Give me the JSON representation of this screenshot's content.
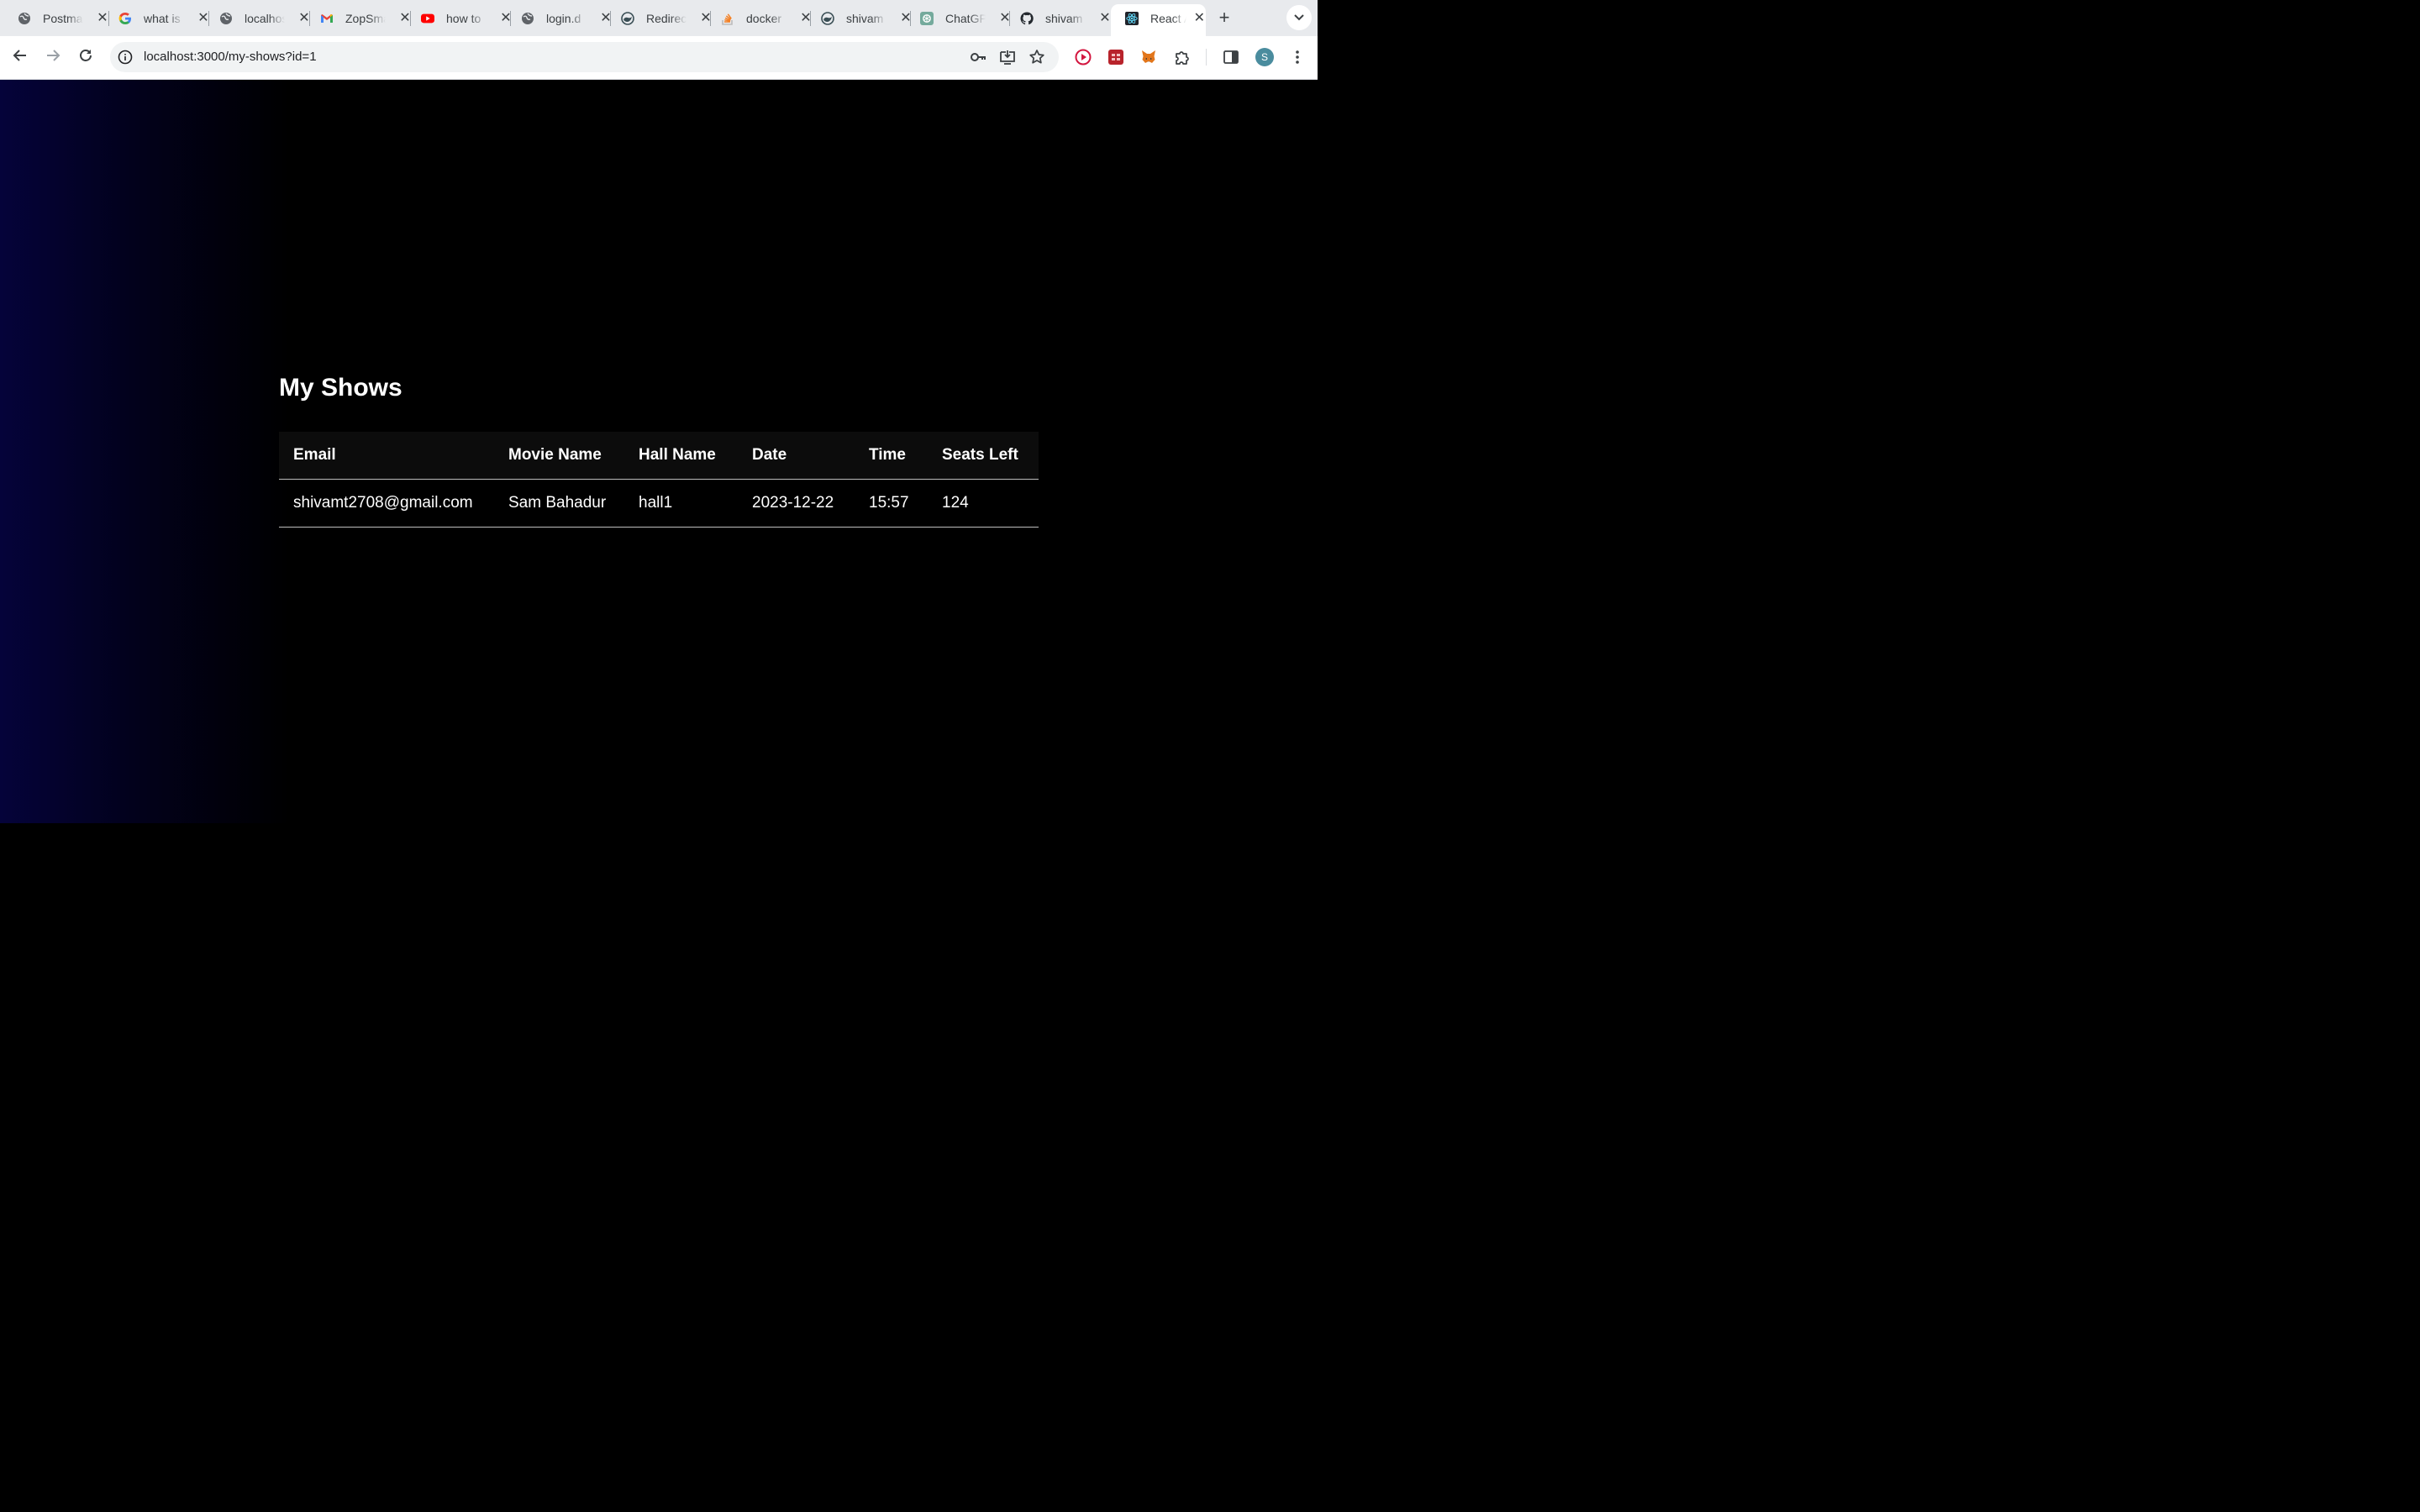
{
  "browser": {
    "tabs": [
      {
        "title": "Postman",
        "icon": "globe-icon"
      },
      {
        "title": "what is",
        "icon": "google-icon"
      },
      {
        "title": "localhost",
        "icon": "globe-icon"
      },
      {
        "title": "ZopSmart",
        "icon": "gmail-icon"
      },
      {
        "title": "how to",
        "icon": "youtube-icon"
      },
      {
        "title": "login.d",
        "icon": "globe-icon"
      },
      {
        "title": "Redirect",
        "icon": "docker-icon"
      },
      {
        "title": "docker",
        "icon": "stackoverflow-icon"
      },
      {
        "title": "shivam",
        "icon": "docker-icon"
      },
      {
        "title": "ChatGPT",
        "icon": "chatgpt-icon"
      },
      {
        "title": "shivam",
        "icon": "github-icon"
      },
      {
        "title": "React App",
        "icon": "react-icon"
      }
    ],
    "active_tab_index": 11,
    "new_tab_label": "+",
    "url": "localhost:3000/my-shows?id=1",
    "profile_initial": "S"
  },
  "page": {
    "heading": "My Shows",
    "table": {
      "headers": [
        "Email",
        "Movie Name",
        "Hall Name",
        "Date",
        "Time",
        "Seats Left"
      ],
      "rows": [
        [
          "shivamt2708@gmail.com",
          "Sam Bahadur",
          "hall1",
          "2023-12-22",
          "15:57",
          "124"
        ]
      ]
    }
  },
  "colors": {
    "page_background": "#000000",
    "page_gradient_left": "#05033a",
    "text": "#ffffff",
    "header_background": "#0c0c0c",
    "row_border": "#bdbdbd"
  }
}
